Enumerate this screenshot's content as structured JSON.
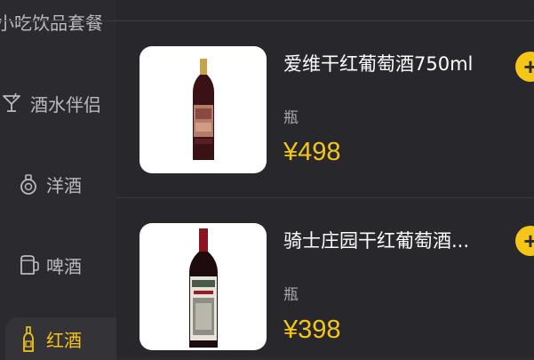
{
  "sidebar": {
    "top_label": "小吃饮品套餐",
    "items": [
      {
        "label": "酒水伴侣",
        "icon": "cocktail-glass-icon"
      },
      {
        "label": "洋酒",
        "icon": "liquor-bottle-icon"
      },
      {
        "label": "啤酒",
        "icon": "beer-mug-icon"
      },
      {
        "label": "红酒",
        "icon": "wine-bottle-icon",
        "active": true
      }
    ]
  },
  "products": [
    {
      "title": "爱维干红葡萄酒750ml",
      "unit": "瓶",
      "price": "¥498",
      "image": "red-wine-bottle-image"
    },
    {
      "title": "骑士庄园干红葡萄酒...",
      "unit": "瓶",
      "price": "¥398",
      "image": "red-wine-bottle-image"
    }
  ],
  "add_button_symbol": "+",
  "colors": {
    "accent": "#f5c518",
    "background": "#2b2b2f",
    "text": "#ffffff",
    "muted_text": "#a9a9b0"
  }
}
